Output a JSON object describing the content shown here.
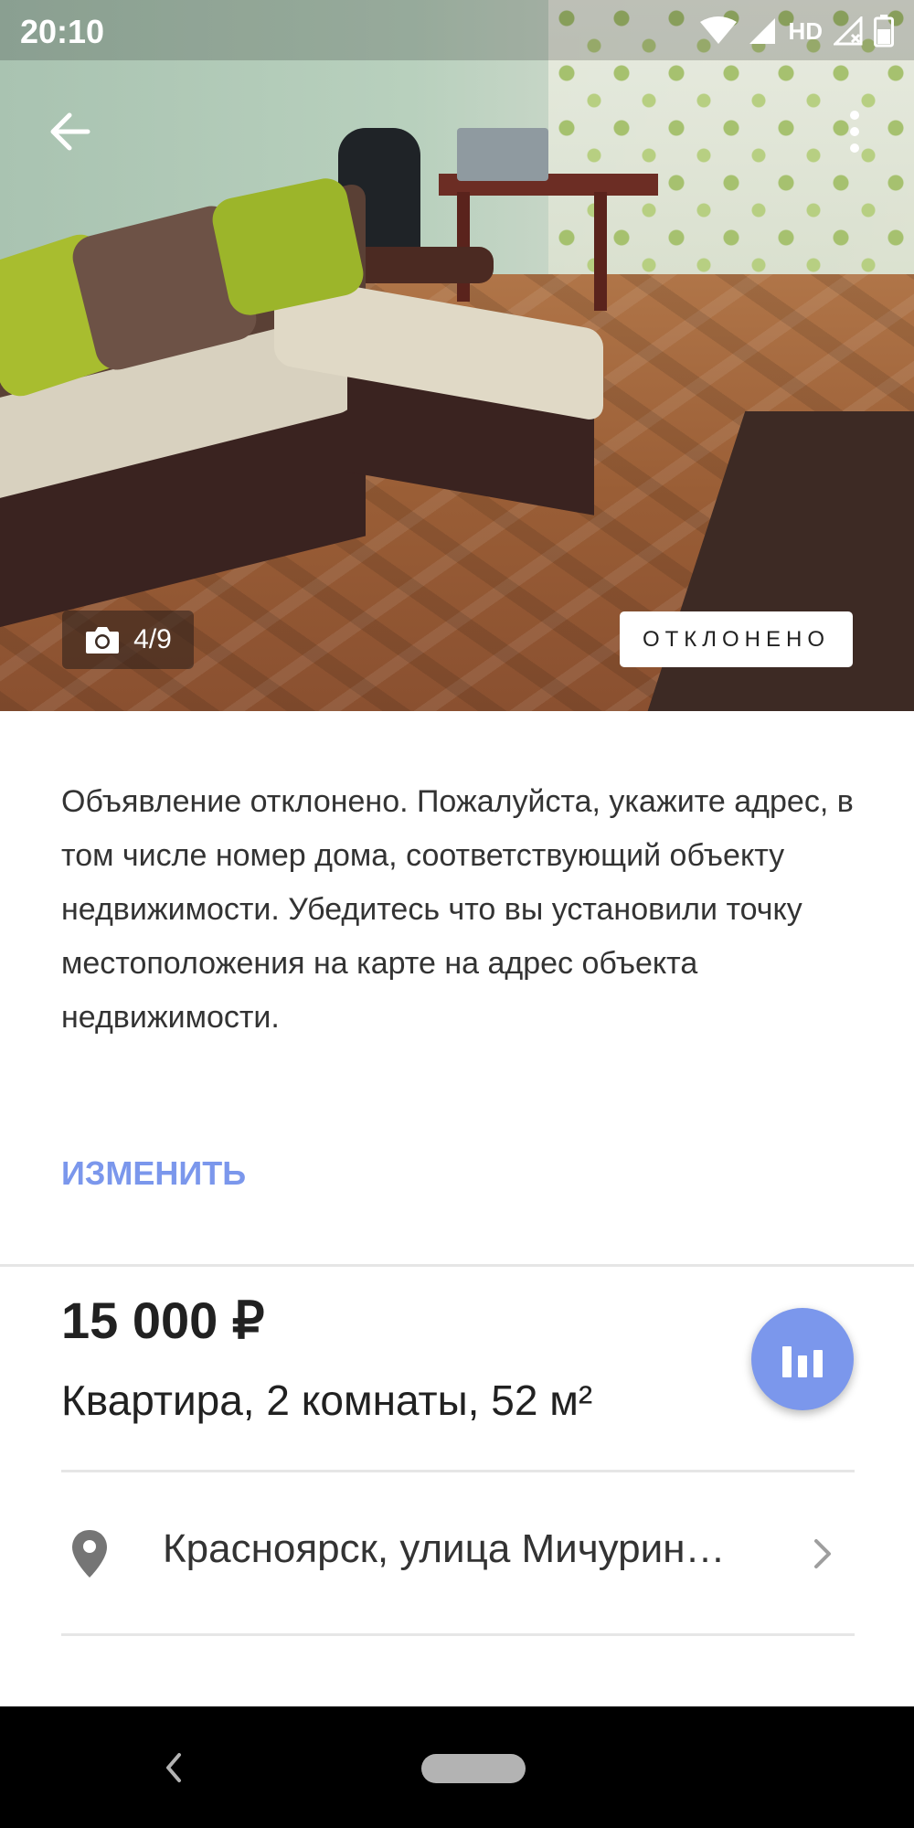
{
  "status_bar": {
    "time": "20:10",
    "network": "HD"
  },
  "photo": {
    "counter": "4/9",
    "status_badge": "ОТКЛОНЕНО"
  },
  "rejection": {
    "message": "Объявление отклонено. Пожалуйста, укажите адрес, в том числе номер дома, соответствующий объекту недвижимости. Убедитесь что вы установили точку местоположения на карте на адрес объекта недвижимости.",
    "edit_label": "ИЗМЕНИТЬ"
  },
  "listing": {
    "price": "15 000 ₽",
    "title": "Квартира, 2 комнаты, 52 м²",
    "address": "Красноярск, улица Мичурин…"
  },
  "colors": {
    "accent": "#7b97ec",
    "badge_bg": "#ffffff",
    "divider": "#e6e6e6"
  },
  "icons": [
    "back-arrow-icon",
    "more-vert-icon",
    "camera-icon",
    "stats-icon",
    "location-pin-icon",
    "chevron-right-icon"
  ]
}
